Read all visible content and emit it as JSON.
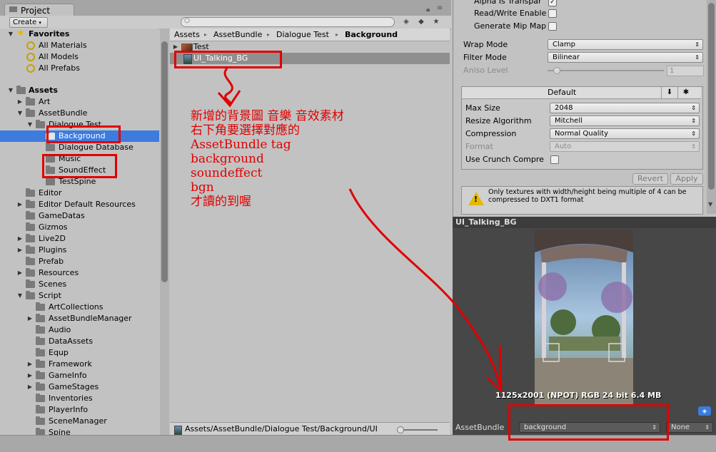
{
  "project_panel": {
    "tab_label": "Project",
    "create_label": "Create",
    "search_placeholder": ""
  },
  "tree": {
    "favorites_label": "Favorites",
    "favorites": [
      "All Materials",
      "All Models",
      "All Prefabs"
    ],
    "assets_label": "Assets",
    "items": [
      {
        "label": "Art"
      },
      {
        "label": "AssetBundle"
      },
      {
        "label": "Dialogue Test"
      },
      {
        "label": "Background"
      },
      {
        "label": "Dialogue Database"
      },
      {
        "label": "Music"
      },
      {
        "label": "SoundEffect"
      },
      {
        "label": "TestSpine"
      },
      {
        "label": "Editor"
      },
      {
        "label": "Editor Default Resources"
      },
      {
        "label": "GameDatas"
      },
      {
        "label": "Gizmos"
      },
      {
        "label": "Live2D"
      },
      {
        "label": "Plugins"
      },
      {
        "label": "Prefab"
      },
      {
        "label": "Resources"
      },
      {
        "label": "Scenes"
      },
      {
        "label": "Script"
      },
      {
        "label": "ArtCollections"
      },
      {
        "label": "AssetBundleManager"
      },
      {
        "label": "Audio"
      },
      {
        "label": "DataAssets"
      },
      {
        "label": "Equp"
      },
      {
        "label": "Framework"
      },
      {
        "label": "GameInfo"
      },
      {
        "label": "GameStages"
      },
      {
        "label": "Inventories"
      },
      {
        "label": "PlayerInfo"
      },
      {
        "label": "SceneManager"
      },
      {
        "label": "Spine"
      }
    ]
  },
  "breadcrumb": {
    "items": [
      "Assets",
      "AssetBundle",
      "Dialogue Test",
      "Background"
    ],
    "separator": "▸"
  },
  "file_list": {
    "items": [
      "Test",
      "UI_Talking_BG"
    ]
  },
  "status_path": "Assets/AssetBundle/Dialogue Test/Background/UI",
  "annotation": {
    "lines": [
      "新增的背景圖 音樂 音效素材",
      "右下角要選擇對應的",
      "AssetBundle tag",
      "background",
      "soundeffect",
      "bgn",
      "才讀的到喔"
    ]
  },
  "inspector": {
    "alpha_transparency_label": "Alpha Is Transpar",
    "read_write_label": "Read/Write Enable",
    "generate_mip_label": "Generate Mip Map",
    "wrap_mode_label": "Wrap Mode",
    "wrap_mode_value": "Clamp",
    "filter_mode_label": "Filter Mode",
    "filter_mode_value": "Bilinear",
    "aniso_label": "Aniso Level",
    "aniso_value": "1",
    "platform_label": "Default",
    "max_size_label": "Max Size",
    "max_size_value": "2048",
    "resize_label": "Resize Algorithm",
    "resize_value": "Mitchell",
    "compression_label": "Compression",
    "compression_value": "Normal Quality",
    "format_label": "Format",
    "format_value": "Auto",
    "crunch_label": "Use Crunch Compre",
    "revert_label": "Revert",
    "apply_label": "Apply",
    "warning_text": "Only textures with width/height being multiple of 4 can be compressed to DXT1 format"
  },
  "preview": {
    "title": "UI_Talking_BG",
    "info": "1125x2001 (NPOT)  RGB 24 bit   6.4 MB"
  },
  "assetbundle": {
    "label": "AssetBundle",
    "name_value": "background",
    "variant_value": "None"
  },
  "colors": {
    "annotation_red": "#e00000",
    "selection_blue": "#3d7bde"
  }
}
